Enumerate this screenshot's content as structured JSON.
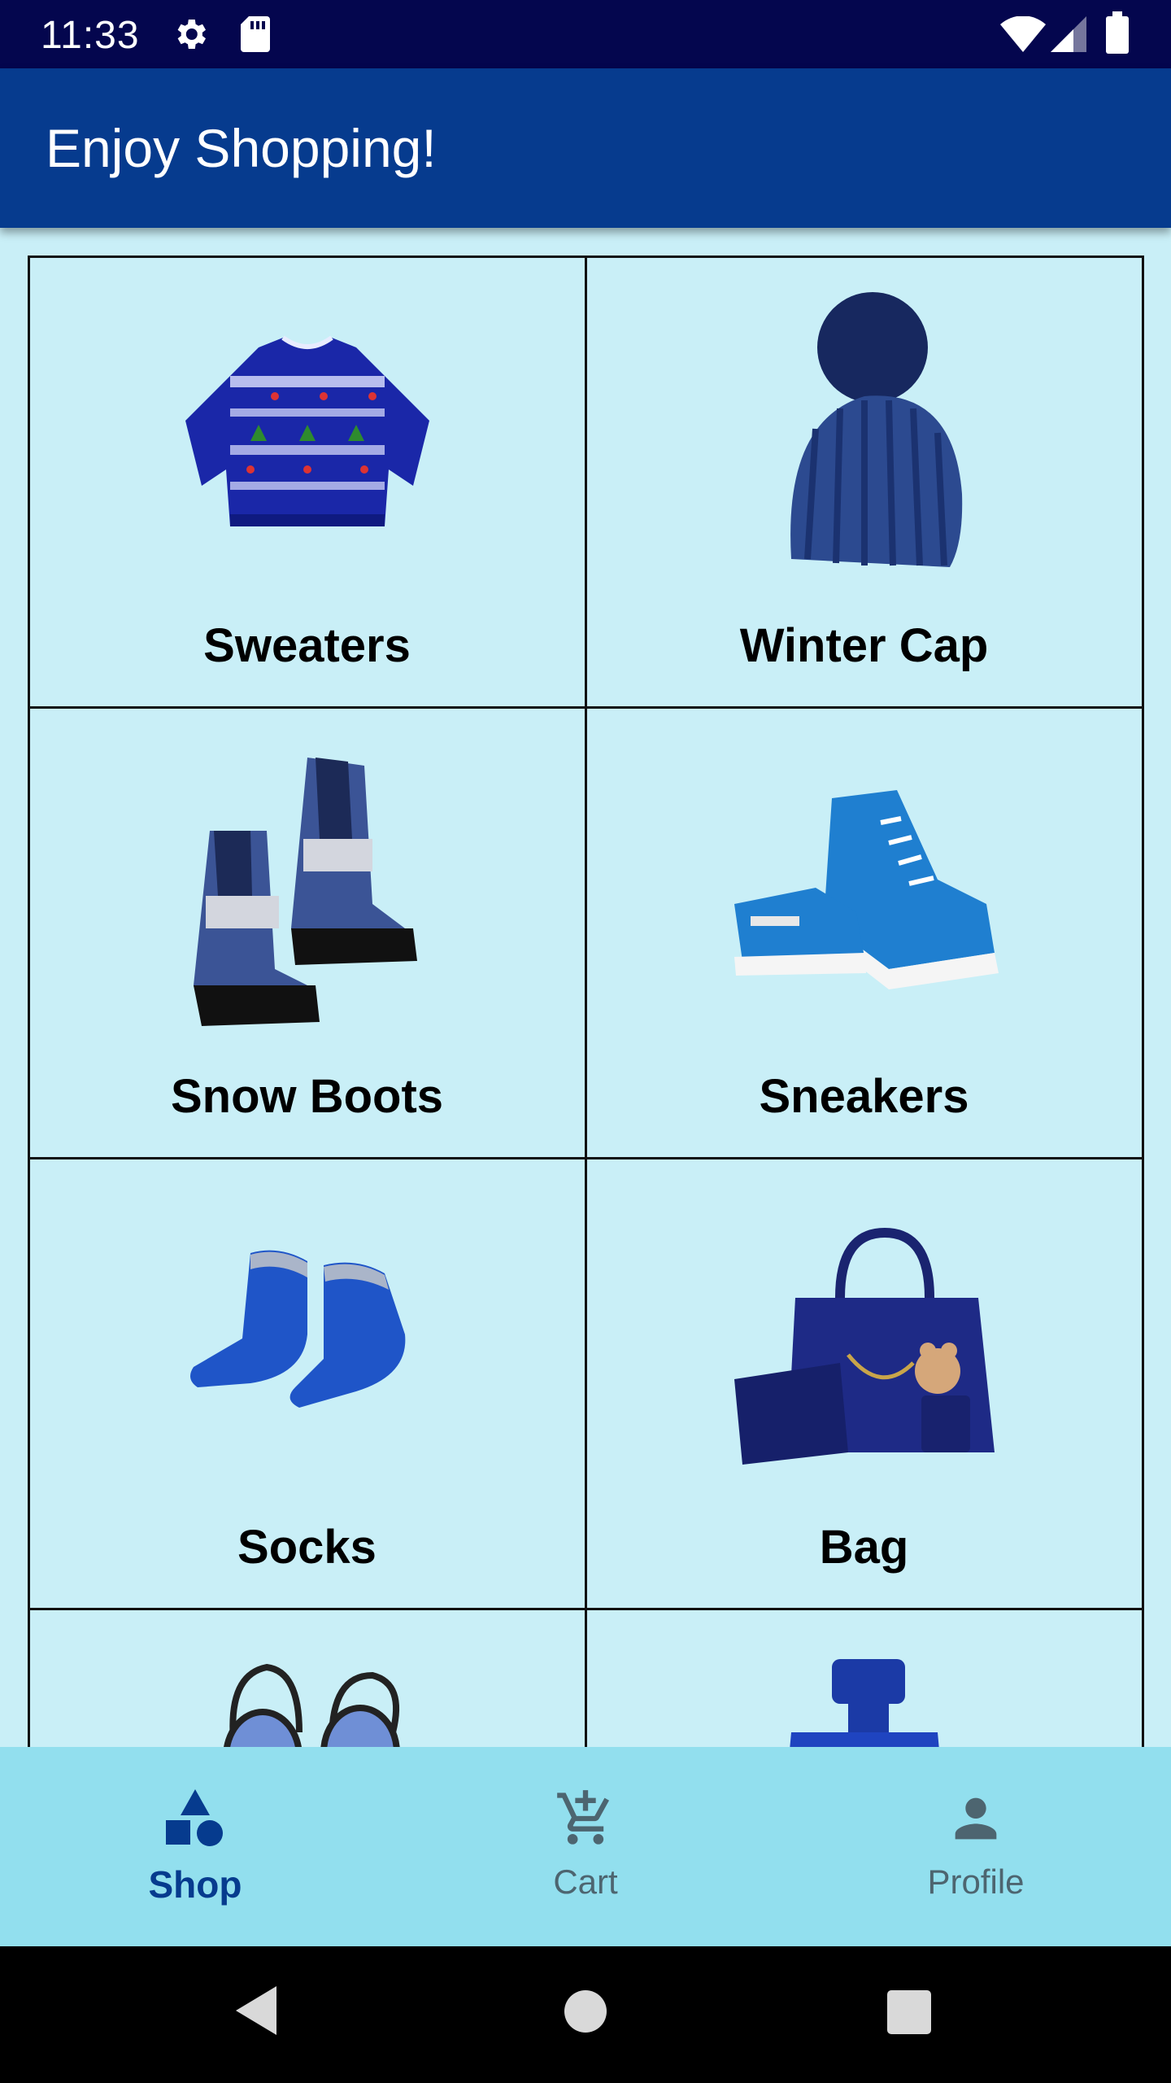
{
  "status_bar": {
    "time": "11:33",
    "icons": [
      "gear-icon",
      "sd-card-icon",
      "wifi-icon",
      "signal-icon",
      "battery-icon"
    ]
  },
  "app_bar": {
    "title": "Enjoy Shopping!"
  },
  "colors": {
    "status_bar": "#04064e",
    "app_bar": "#063b8e",
    "background": "#c9eff7",
    "bottom_nav": "#92dfee",
    "active_nav": "#063b8e",
    "inactive_nav": "#4d6570"
  },
  "products": [
    {
      "label": "Sweaters",
      "image": "sweater-image"
    },
    {
      "label": "Winter Cap",
      "image": "winter-cap-image"
    },
    {
      "label": "Snow Boots",
      "image": "snow-boots-image"
    },
    {
      "label": "Sneakers",
      "image": "sneakers-image"
    },
    {
      "label": "Socks",
      "image": "socks-image"
    },
    {
      "label": "Bag",
      "image": "bag-image"
    },
    {
      "label": "",
      "image": "goggles-image"
    },
    {
      "label": "",
      "image": "perfume-image"
    }
  ],
  "bottom_nav": {
    "items": [
      {
        "label": "Shop",
        "icon": "shapes-icon",
        "active": true
      },
      {
        "label": "Cart",
        "icon": "cart-icon",
        "active": false
      },
      {
        "label": "Profile",
        "icon": "person-icon",
        "active": false
      }
    ]
  },
  "system_nav": {
    "icons": [
      "back-icon",
      "home-icon",
      "recents-icon"
    ]
  }
}
